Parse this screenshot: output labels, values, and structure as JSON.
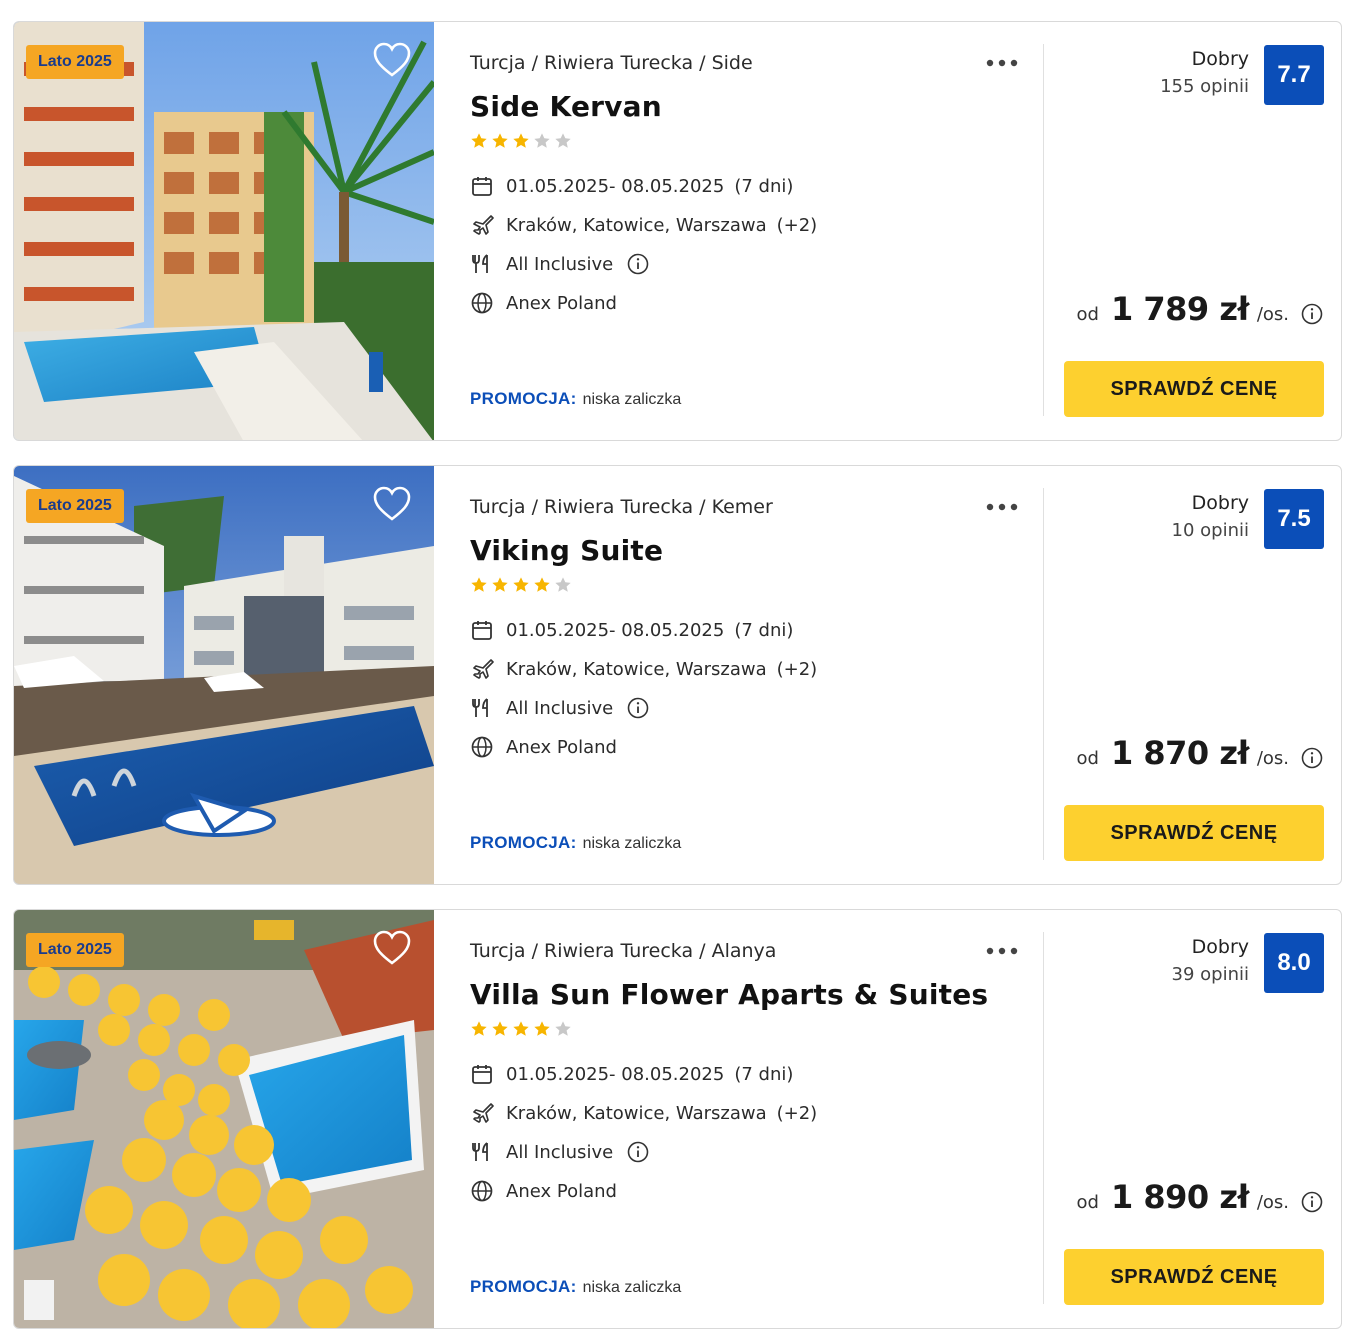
{
  "colors": {
    "badge_bg": "#f5a623",
    "badge_text": "#1b3c8c",
    "score_bg": "#0b4eb8",
    "promo_label": "#0b4eb8",
    "cta_bg": "#fdd02f",
    "star_filled": "#f7b500",
    "star_empty": "#c8c8c8"
  },
  "offers": [
    {
      "badge": "Lato 2025",
      "location": "Turcja / Riwiera Turecka / Side",
      "name": "Side Kervan",
      "stars": 3,
      "stars_max": 5,
      "dates": "01.05.2025- 08.05.2025",
      "duration": "(7 dni)",
      "departures": "Kraków, Katowice, Warszawa",
      "departures_more": "(+2)",
      "board": "All Inclusive",
      "operator": "Anex Poland",
      "promo_label": "PROMOCJA:",
      "promo_value": "niska zaliczka",
      "rating_word": "Dobry",
      "rating_count": "155 opinii",
      "score": "7.7",
      "price_prefix": "od",
      "price": "1 789 zł",
      "price_suffix": "/os.",
      "cta": "SPRAWDŹ CENĘ",
      "icons": {
        "favorite": "heart-outline-icon",
        "menu": "more-dots-icon",
        "calendar": "calendar-icon",
        "plane": "plane-icon",
        "board": "cutlery-icon",
        "operator": "globe-icon",
        "info": "info-icon"
      }
    },
    {
      "badge": "Lato 2025",
      "location": "Turcja / Riwiera Turecka / Kemer",
      "name": "Viking Suite",
      "stars": 4,
      "stars_max": 5,
      "dates": "01.05.2025- 08.05.2025",
      "duration": "(7 dni)",
      "departures": "Kraków, Katowice, Warszawa",
      "departures_more": "(+2)",
      "board": "All Inclusive",
      "operator": "Anex Poland",
      "promo_label": "PROMOCJA:",
      "promo_value": "niska zaliczka",
      "rating_word": "Dobry",
      "rating_count": "10 opinii",
      "score": "7.5",
      "price_prefix": "od",
      "price": "1 870 zł",
      "price_suffix": "/os.",
      "cta": "SPRAWDŹ CENĘ",
      "icons": {
        "favorite": "heart-outline-icon",
        "menu": "more-dots-icon",
        "calendar": "calendar-icon",
        "plane": "plane-icon",
        "board": "cutlery-icon",
        "operator": "globe-icon",
        "info": "info-icon"
      }
    },
    {
      "badge": "Lato 2025",
      "location": "Turcja / Riwiera Turecka / Alanya",
      "name": "Villa Sun Flower Aparts & Suites",
      "stars": 4,
      "stars_max": 5,
      "dates": "01.05.2025- 08.05.2025",
      "duration": "(7 dni)",
      "departures": "Kraków, Katowice, Warszawa",
      "departures_more": "(+2)",
      "board": "All Inclusive",
      "operator": "Anex Poland",
      "promo_label": "PROMOCJA:",
      "promo_value": "niska zaliczka",
      "rating_word": "Dobry",
      "rating_count": "39 opinii",
      "score": "8.0",
      "price_prefix": "od",
      "price": "1 890 zł",
      "price_suffix": "/os.",
      "cta": "SPRAWDŹ CENĘ",
      "icons": {
        "favorite": "heart-outline-icon",
        "menu": "more-dots-icon",
        "calendar": "calendar-icon",
        "plane": "plane-icon",
        "board": "cutlery-icon",
        "operator": "globe-icon",
        "info": "info-icon"
      }
    }
  ]
}
